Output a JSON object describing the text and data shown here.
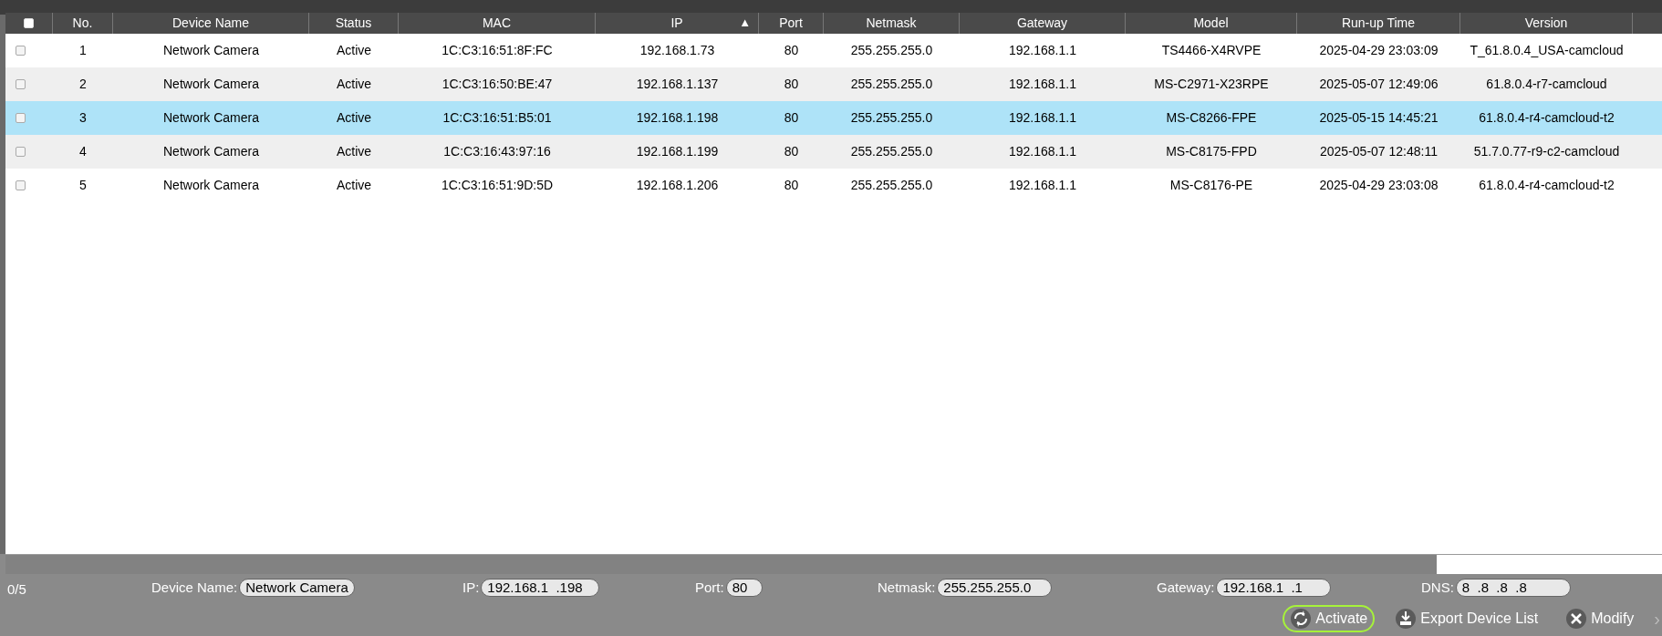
{
  "table": {
    "select_all_checked": false,
    "columns": [
      {
        "label": "No."
      },
      {
        "label": "Device Name"
      },
      {
        "label": "Status"
      },
      {
        "label": "MAC"
      },
      {
        "label": "IP",
        "sort_indicator": "▲"
      },
      {
        "label": "Port"
      },
      {
        "label": "Netmask"
      },
      {
        "label": "Gateway"
      },
      {
        "label": "Model"
      },
      {
        "label": "Run-up Time"
      },
      {
        "label": "Version"
      }
    ],
    "rows": [
      {
        "checked": false,
        "selected": false,
        "cells": [
          "1",
          "Network Camera",
          "Active",
          "1C:C3:16:51:8F:FC",
          "192.168.1.73",
          "80",
          "255.255.255.0",
          "192.168.1.1",
          "TS4466-X4RVPE",
          "2025-04-29 23:03:09",
          "T_61.8.0.4_USA-camcloud"
        ]
      },
      {
        "checked": false,
        "selected": false,
        "cells": [
          "2",
          "Network Camera",
          "Active",
          "1C:C3:16:50:BE:47",
          "192.168.1.137",
          "80",
          "255.255.255.0",
          "192.168.1.1",
          "MS-C2971-X23RPE",
          "2025-05-07 12:49:06",
          "61.8.0.4-r7-camcloud"
        ]
      },
      {
        "checked": false,
        "selected": true,
        "cells": [
          "3",
          "Network Camera",
          "Active",
          "1C:C3:16:51:B5:01",
          "192.168.1.198",
          "80",
          "255.255.255.0",
          "192.168.1.1",
          "MS-C8266-FPE",
          "2025-05-15 14:45:21",
          "61.8.0.4-r4-camcloud-t2"
        ]
      },
      {
        "checked": false,
        "selected": false,
        "cells": [
          "4",
          "Network Camera",
          "Active",
          "1C:C3:16:43:97:16",
          "192.168.1.199",
          "80",
          "255.255.255.0",
          "192.168.1.1",
          "MS-C8175-FPD",
          "2025-05-07 12:48:11",
          "51.7.0.77-r9-c2-camcloud"
        ]
      },
      {
        "checked": false,
        "selected": false,
        "cells": [
          "5",
          "Network Camera",
          "Active",
          "1C:C3:16:51:9D:5D",
          "192.168.1.206",
          "80",
          "255.255.255.0",
          "192.168.1.1",
          "MS-C8176-PE",
          "2025-04-29 23:03:08",
          "61.8.0.4-r4-camcloud-t2"
        ]
      }
    ]
  },
  "footer": {
    "count": "0/5",
    "fields": [
      {
        "label": "Device Name:",
        "value": "Network Camera"
      },
      {
        "label": "IP:",
        "value": "192.168.1  .198"
      },
      {
        "label": "Port:",
        "value": "80"
      },
      {
        "label": "Netmask:",
        "value": "255.255.255.0"
      },
      {
        "label": "Gateway:",
        "value": "192.168.1  .1"
      },
      {
        "label": "DNS:",
        "value": "8  .8  .8  .8"
      }
    ],
    "buttons": [
      {
        "kind": "activate",
        "label": "Activate",
        "highlighted": true
      },
      {
        "kind": "export",
        "label": "Export Device List",
        "highlighted": false
      },
      {
        "kind": "modify",
        "label": "Modify",
        "highlighted": false
      }
    ],
    "more": "›"
  }
}
